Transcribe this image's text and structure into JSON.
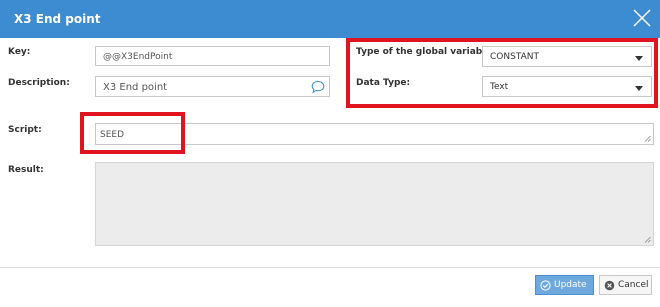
{
  "dialog": {
    "title": "X3 End point"
  },
  "form": {
    "key_label": "Key:",
    "key_value": "@@X3EndPoint",
    "description_label": "Description:",
    "description_value": "X3 End point",
    "type_label": "Type of the global variable:",
    "type_value": "CONSTANT",
    "data_type_label": "Data Type:",
    "data_type_value": "Text",
    "script_label": "Script:",
    "script_value": "SEED",
    "result_label": "Result:",
    "result_value": ""
  },
  "footer": {
    "update_label": "Update",
    "cancel_label": "Cancel"
  },
  "colors": {
    "titlebar": "#3d8bd0",
    "highlight": "#e0141e",
    "update_button": "#6fa8dc"
  },
  "icons": {
    "close": "close-icon",
    "comment": "comment-bubble-icon",
    "update": "check-circle-icon",
    "cancel": "x-circle-icon"
  }
}
